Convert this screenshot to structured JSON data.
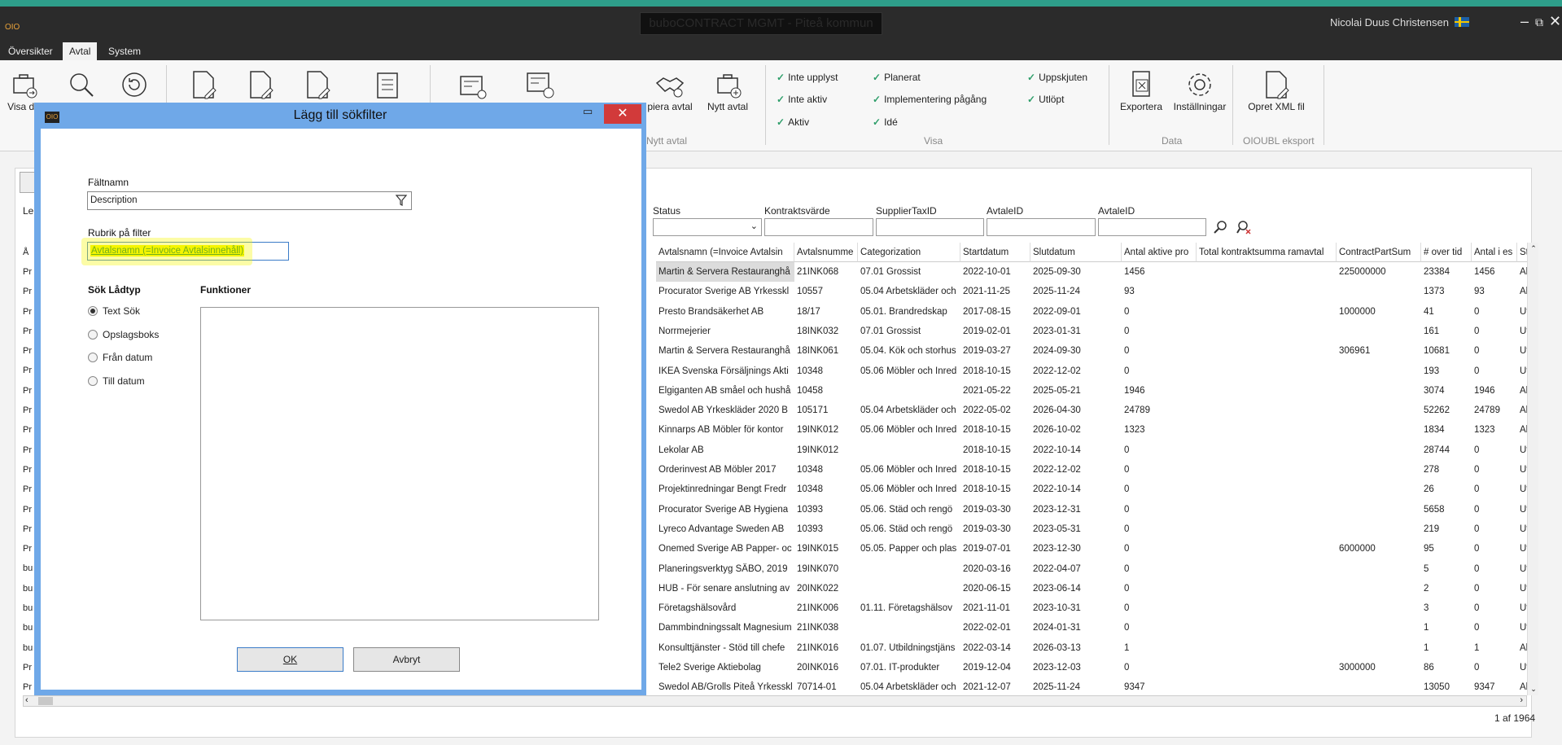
{
  "window": {
    "logo": "OIO",
    "title": "buboCONTRACT MGMT - Piteå kommun",
    "user": "Nicolai Duus Christensen",
    "controls": {
      "minimize": "–",
      "restore": "⧉",
      "close": "✕"
    }
  },
  "menu": [
    "Översikter",
    "Avtal",
    "System"
  ],
  "ribbon": {
    "buttons": [
      {
        "label": "Visa de",
        "icon": "briefcase-arrow-icon"
      },
      {
        "label": "",
        "icon": "search-icon"
      },
      {
        "label": "",
        "icon": "refresh-icon"
      },
      {
        "label": "",
        "icon": "doc-edit-icon"
      },
      {
        "label": "",
        "icon": "doc-edit-icon"
      },
      {
        "label": "",
        "icon": "doc-edit-icon"
      },
      {
        "label": "",
        "icon": "doc-list-icon"
      },
      {
        "label": "",
        "icon": "register-icon"
      },
      {
        "label": "",
        "icon": "register-refresh-icon"
      },
      {
        "label": "piera avtal",
        "icon": "handshake-add-icon"
      },
      {
        "label": "Nytt avtal",
        "icon": "briefcase-add-icon"
      }
    ],
    "group_new": "Nytt avtal",
    "visa_checks": [
      [
        "Inte upplyst",
        "Planerat",
        "Uppskjuten"
      ],
      [
        "Inte aktiv",
        "Implementering pågång",
        "Utlöpt"
      ],
      [
        "Aktiv",
        "Idé",
        ""
      ]
    ],
    "group_visa": "Visa",
    "data_buttons": [
      {
        "label": "Exportera"
      },
      {
        "label": "Inställningar"
      }
    ],
    "group_data": "Data",
    "xml_button": "Opret XML fil",
    "group_oioubl": "OIOUBL eksport"
  },
  "filters": {
    "left_label": "Le",
    "labels": [
      "Status",
      "Kontraktsvärde",
      "SupplierTaxID",
      "AvtaleID",
      "AvtaleID"
    ]
  },
  "grid": {
    "headers": [
      "Avtalsnamn (=Invoice Avtalsin",
      "Avtalsnumme",
      "Categorization",
      "Startdatum",
      "Slutdatum",
      "Antal aktive pro",
      "Total kontraktsumma ramavtal",
      "ContractPartSum",
      "# over tid",
      "Antal i es",
      "St"
    ],
    "rows": [
      [
        "Martin & Servera Restauranghå",
        "21INK068",
        "07.01 Grossist",
        "2022-10-01",
        "2025-09-30",
        "1456",
        "",
        "225000000",
        "23384",
        "1456",
        "Ak"
      ],
      [
        "Procurator Sverige AB Yrkesskl",
        "10557",
        "05.04 Arbetskläder och",
        "2021-11-25",
        "2025-11-24",
        "93",
        "",
        "",
        "1373",
        "93",
        "Ak"
      ],
      [
        "Presto Brandsäkerhet AB",
        "18/17",
        "05.01. Brandredskap",
        "2017-08-15",
        "2022-09-01",
        "0",
        "",
        "1000000",
        "41",
        "0",
        "Ut"
      ],
      [
        "Norrmejerier",
        "18INK032",
        "07.01 Grossist",
        "2019-02-01",
        "2023-01-31",
        "0",
        "",
        "",
        "161",
        "0",
        "Ut"
      ],
      [
        "Martin & Servera Restauranghå",
        "18INK061",
        "05.04. Kök och storhus",
        "2019-03-27",
        "2024-09-30",
        "0",
        "",
        "306961",
        "10681",
        "0",
        "Ut"
      ],
      [
        "IKEA Svenska Försäljnings Akti",
        "10348",
        "05.06 Möbler och Inred",
        "2018-10-15",
        "2022-12-02",
        "0",
        "",
        "",
        "193",
        "0",
        "Ut"
      ],
      [
        "Elgiganten AB småel och hushå",
        "10458",
        "",
        "2021-05-22",
        "2025-05-21",
        "1946",
        "",
        "",
        "3074",
        "1946",
        "Ak"
      ],
      [
        "Swedol AB Yrkeskläder 2020 B",
        "105171",
        "05.04 Arbetskläder och",
        "2022-05-02",
        "2026-04-30",
        "24789",
        "",
        "",
        "52262",
        "24789",
        "Ak"
      ],
      [
        "Kinnarps AB Möbler för kontor",
        "19INK012",
        "05.06 Möbler och Inred",
        "2018-10-15",
        "2026-10-02",
        "1323",
        "",
        "",
        "1834",
        "1323",
        "Ak"
      ],
      [
        "Lekolar AB",
        "19INK012",
        "",
        "2018-10-15",
        "2022-10-14",
        "0",
        "",
        "",
        "28744",
        "0",
        "Ut"
      ],
      [
        "Orderinvest AB Möbler 2017",
        "10348",
        "05.06 Möbler och Inred",
        "2018-10-15",
        "2022-12-02",
        "0",
        "",
        "",
        "278",
        "0",
        "Ut"
      ],
      [
        "Projektinredningar Bengt Fredr",
        "10348",
        "05.06 Möbler och Inred",
        "2018-10-15",
        "2022-10-14",
        "0",
        "",
        "",
        "26",
        "0",
        "Ut"
      ],
      [
        "Procurator Sverige AB Hygiena",
        "10393",
        "05.06. Städ och rengö",
        "2019-03-30",
        "2023-12-31",
        "0",
        "",
        "",
        "5658",
        "0",
        "Ut"
      ],
      [
        "Lyreco Advantage Sweden AB",
        "10393",
        "05.06. Städ och rengö",
        "2019-03-30",
        "2023-05-31",
        "0",
        "",
        "",
        "219",
        "0",
        "Ut"
      ],
      [
        "Onemed Sverige AB Papper- oc",
        "19INK015",
        "05.05. Papper och plas",
        "2019-07-01",
        "2023-12-30",
        "0",
        "",
        "6000000",
        "95",
        "0",
        "Ut"
      ],
      [
        "Planeringsverktyg SÄBO, 2019",
        "19INK070",
        "",
        "2020-03-16",
        "2022-04-07",
        "0",
        "",
        "",
        "5",
        "0",
        "Ut"
      ],
      [
        "HUB - För senare anslutning av",
        "20INK022",
        "",
        "2020-06-15",
        "2023-06-14",
        "0",
        "",
        "",
        "2",
        "0",
        "Ut"
      ],
      [
        "Företagshälsovård",
        "21INK006",
        "01.11. Företagshälsov",
        "2021-11-01",
        "2023-10-31",
        "0",
        "",
        "",
        "3",
        "0",
        "Ut"
      ],
      [
        "Dammbindningssalt Magnesium",
        "21INK038",
        "",
        "2022-02-01",
        "2024-01-31",
        "0",
        "",
        "",
        "1",
        "0",
        "Ut"
      ],
      [
        "Konsulttjänster - Stöd till chefe",
        "21INK016",
        "01.07. Utbildningstjäns",
        "2022-03-14",
        "2026-03-13",
        "1",
        "",
        "",
        "1",
        "1",
        "Ak"
      ],
      [
        "Tele2 Sverige Aktiebolag",
        "20INK016",
        "07.01. IT-produkter",
        "2019-12-04",
        "2023-12-03",
        "0",
        "",
        "3000000",
        "86",
        "0",
        "Ut"
      ],
      [
        "Swedol AB/Grolls Piteå Yrkesskl",
        "70714-01",
        "05.04 Arbetskläder och",
        "2021-12-07",
        "2025-11-24",
        "9347",
        "",
        "",
        "13050",
        "9347",
        "Ak"
      ]
    ],
    "left_col": [
      "Å",
      "Pr",
      "Pr",
      "Pr",
      "Pr",
      "Pr",
      "Pr",
      "Pr",
      "Pr",
      "Pr",
      "Pr",
      "Pr",
      "Pr",
      "Pr",
      "Pr",
      "Pr",
      "bu",
      "bu",
      "bu",
      "bu",
      "bu",
      "Pr",
      "Pr"
    ]
  },
  "pager": "1 af 1964",
  "dialog": {
    "title": "Lägg till sökfilter",
    "field_label": "Fältnamn",
    "field_value": "Description",
    "caption_label": "Rubrik på filter",
    "caption_value": "Avtalsnamn (=Invoice Avtalsinnehåll)",
    "type_heading": "Sök Lådtyp",
    "types": [
      "Text Sök",
      "Opslagsboks",
      "Från datum",
      "Till datum"
    ],
    "selected_type": 0,
    "functions_heading": "Funktioner",
    "ok": "OK",
    "cancel": "Avbryt"
  },
  "colors": {
    "accent": "#2e9e8a",
    "dialog_frame": "#6fa8e8",
    "highlight": "#f5f500"
  }
}
